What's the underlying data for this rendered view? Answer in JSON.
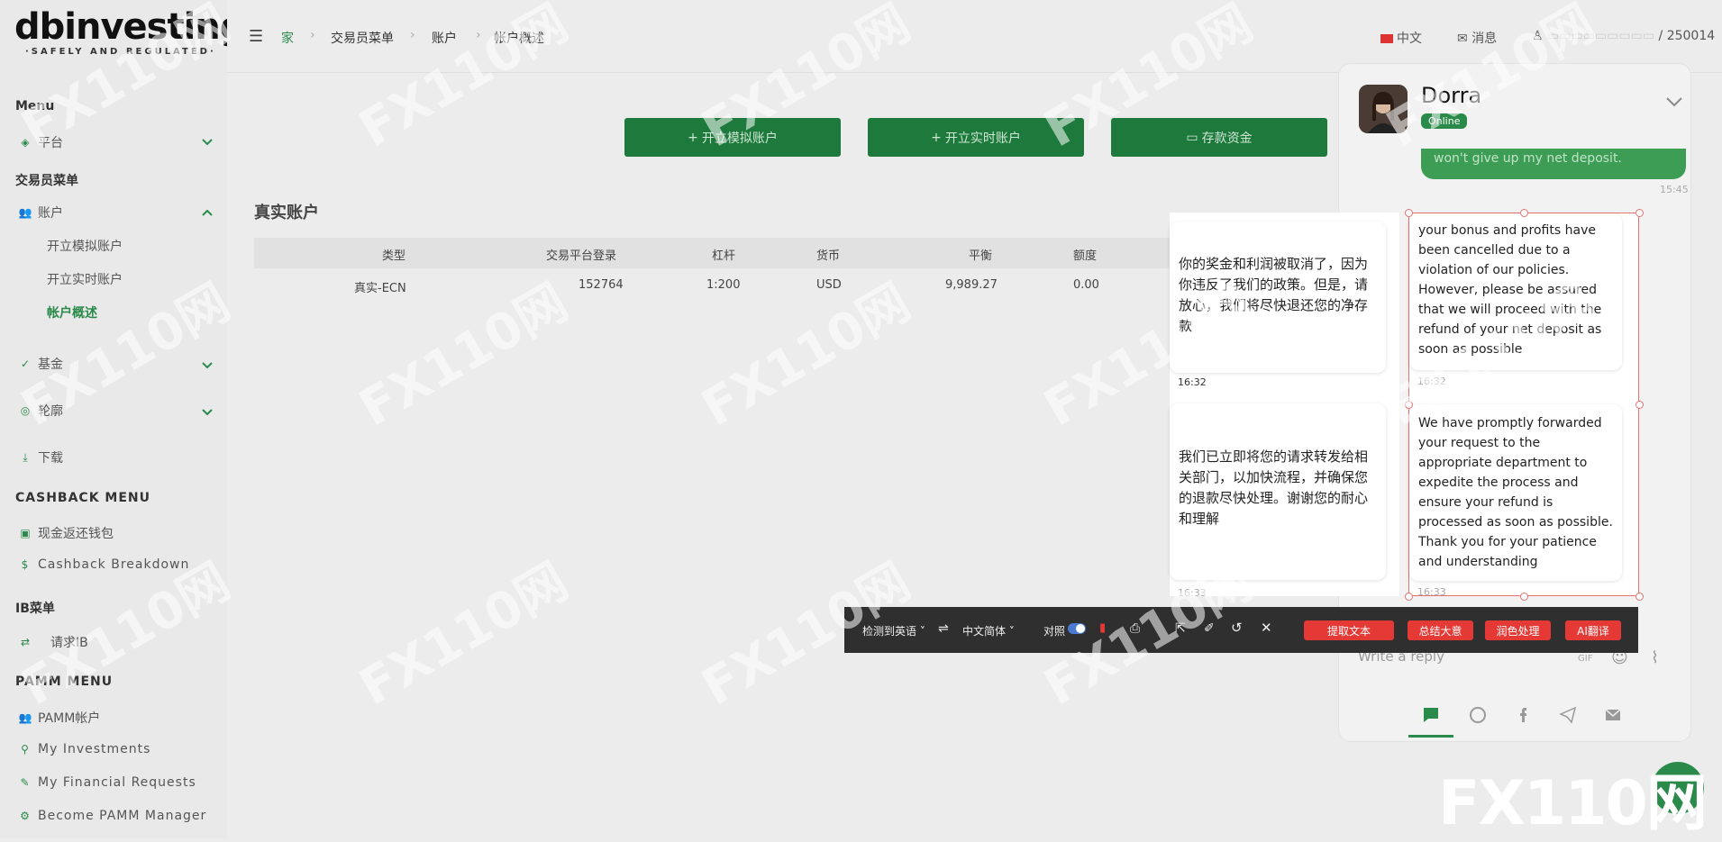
{
  "logo": {
    "brand": "dbinvesting",
    "tagline": "·SAFELY AND REGULATED·"
  },
  "sidebar": {
    "menu_title": "Menu",
    "platform": "平台",
    "trader_menu": "交易员菜单",
    "account": "账户",
    "account_sub": [
      "开立模拟账户",
      "开立实时账户",
      "帐户概述"
    ],
    "funds": "基金",
    "profile": "轮廓",
    "download": "下载",
    "cashback_menu": "CASHBACK MENU",
    "cashback_wallet": "现金返还钱包",
    "cashback_breakdown": "Cashback Breakdown",
    "ib_menu": "IB菜单",
    "request_ib": "请求IB",
    "pamm_menu": "PAMM MENU",
    "pamm_account": "PAMM帐户",
    "my_investments": "My Investments",
    "my_financial_requests": "My Financial Requests",
    "become_pamm_manager": "Become PAMM Manager"
  },
  "topbar": {
    "breadcrumb": [
      "家",
      "交易员菜单",
      "账户",
      "帐户概述"
    ],
    "language": "中文",
    "messages": "消息",
    "user": "/ 250014"
  },
  "main": {
    "buttons": [
      "开立模拟账户",
      "开立实时账户",
      "存款资金"
    ],
    "section_title": "真实账户",
    "table": {
      "headers": [
        "类型",
        "交易平台登录",
        "杠杆",
        "货币",
        "平衡",
        "额度"
      ],
      "rows": [
        [
          "真实-ECN",
          "152764",
          "1:200",
          "USD",
          "9,989.27",
          "0.00"
        ]
      ]
    }
  },
  "chat": {
    "agent_name": "Dorra",
    "status": "Online",
    "prev_message": "won't give up my net deposit.",
    "prev_time": "15:45",
    "reply_placeholder": "Write a reply",
    "gif_label": "GIF"
  },
  "translation": {
    "source": [
      {
        "text": "你的奖金和利润被取消了，因为你违反了我们的政策。但是，请放心，我们将尽快退还您的净存款",
        "time": "16:32"
      },
      {
        "text": "我们已立即将您的请求转发给相关部门，以加快流程，并确保您的退款尽快处理。谢谢您的耐心和理解",
        "time": "16:33"
      }
    ],
    "target": [
      {
        "text": "your bonus and profits have been cancelled due to a violation of our policies. However, please be assured that we will proceed with the refund of your net deposit as soon as possible",
        "time": "16:32"
      },
      {
        "text": "We have promptly forwarded your request to the appropriate department to expedite the process and ensure your refund is processed as soon as possible. Thank you for your patience and understanding",
        "time": "16:33"
      }
    ]
  },
  "toolbar": {
    "detect": "检测到英语",
    "target_lang": "中文简体",
    "compare": "对照",
    "extract": "提取文本",
    "summarize": "总结大意",
    "polish": "润色处理",
    "ai_translate": "AI翻译"
  },
  "watermark": {
    "text": "FX110网",
    "corner": "FX110网"
  },
  "colors": {
    "accent": "#2a8a4a",
    "red": "#e53935",
    "toolbar": "#2f2f2f"
  }
}
